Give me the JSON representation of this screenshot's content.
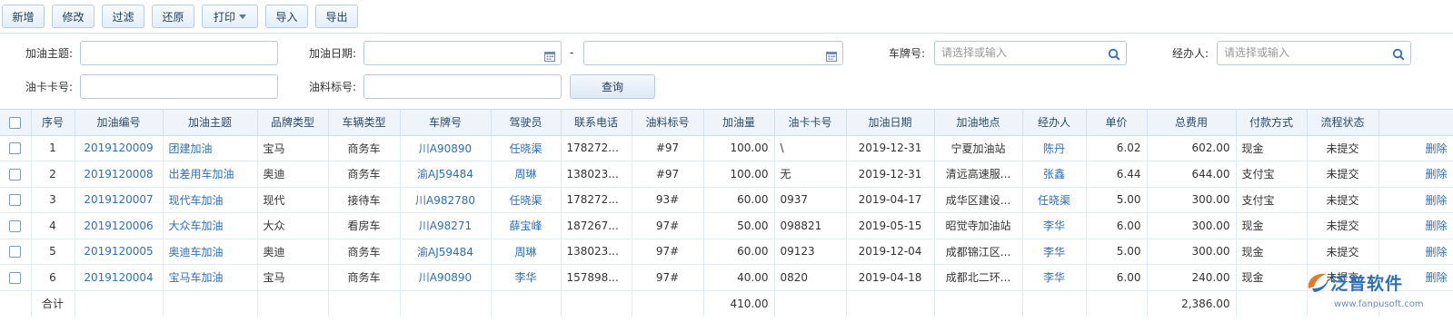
{
  "toolbar": {
    "buttons": [
      {
        "label": "新增"
      },
      {
        "label": "修改"
      },
      {
        "label": "过滤"
      },
      {
        "label": "还原"
      },
      {
        "label": "打印"
      },
      {
        "label": "导入"
      },
      {
        "label": "导出"
      }
    ]
  },
  "filters": {
    "subject_label": "加油主题:",
    "date_label": "加油日期:",
    "date_separator": "-",
    "plate_label": "车牌号:",
    "plate_placeholder": "请选择或输入",
    "handler_label": "经办人:",
    "handler_placeholder": "请选择或输入",
    "card_label": "油卡卡号:",
    "fuel_label": "油料标号:",
    "query_label": "查询"
  },
  "table": {
    "headers": [
      "序号",
      "加油编号",
      "加油主题",
      "品牌类型",
      "车辆类型",
      "车牌号",
      "驾驶员",
      "联系电话",
      "油料标号",
      "加油量",
      "油卡卡号",
      "加油日期",
      "加油地点",
      "经办人",
      "单价",
      "总费用",
      "付款方式",
      "流程状态"
    ],
    "rows": [
      {
        "no": "1",
        "code": "2019120009",
        "subject": "团建加油",
        "brand": "宝马",
        "vtype": "商务车",
        "plate": "川A90890",
        "driver": "任晓渠",
        "phone": "178272...",
        "fuel": "#97",
        "amount": "100.00",
        "card": "\\",
        "date": "2019-12-31",
        "place": "宁夏加油站",
        "handler": "陈丹",
        "price": "6.02",
        "total": "602.00",
        "pay": "现金",
        "status": "未提交",
        "action": "删除"
      },
      {
        "no": "2",
        "code": "2019120008",
        "subject": "出差用车加油",
        "brand": "奥迪",
        "vtype": "商务车",
        "plate": "渝AJ59484",
        "driver": "周琳",
        "phone": "138023...",
        "fuel": "#97",
        "amount": "100.00",
        "card": "无",
        "date": "2019-12-31",
        "place": "清远高速服...",
        "handler": "张鑫",
        "price": "6.44",
        "total": "644.00",
        "pay": "支付宝",
        "status": "未提交",
        "action": "删除"
      },
      {
        "no": "3",
        "code": "2019120007",
        "subject": "现代车加油",
        "brand": "现代",
        "vtype": "接待车",
        "plate": "川A982780",
        "driver": "任晓渠",
        "phone": "178272...",
        "fuel": "93#",
        "amount": "60.00",
        "card": "0937",
        "date": "2019-04-17",
        "place": "成华区建设...",
        "handler": "任晓渠",
        "price": "5.00",
        "total": "300.00",
        "pay": "支付宝",
        "status": "未提交",
        "action": "删除"
      },
      {
        "no": "4",
        "code": "2019120006",
        "subject": "大众车加油",
        "brand": "大众",
        "vtype": "看房车",
        "plate": "川A98271",
        "driver": "薛宝峰",
        "phone": "187267...",
        "fuel": "97#",
        "amount": "50.00",
        "card": "098821",
        "date": "2019-05-15",
        "place": "昭觉寺加油站",
        "handler": "李华",
        "price": "6.00",
        "total": "300.00",
        "pay": "现金",
        "status": "未提交",
        "action": "删除"
      },
      {
        "no": "5",
        "code": "2019120005",
        "subject": "奥迪车加油",
        "brand": "奥迪",
        "vtype": "商务车",
        "plate": "渝AJ59484",
        "driver": "周琳",
        "phone": "138023...",
        "fuel": "97#",
        "amount": "60.00",
        "card": "09123",
        "date": "2019-12-04",
        "place": "成都锦江区...",
        "handler": "李华",
        "price": "5.00",
        "total": "300.00",
        "pay": "现金",
        "status": "未提交",
        "action": "删除"
      },
      {
        "no": "6",
        "code": "2019120004",
        "subject": "宝马车加油",
        "brand": "宝马",
        "vtype": "商务车",
        "plate": "川A90890",
        "driver": "李华",
        "phone": "157898...",
        "fuel": "97#",
        "amount": "40.00",
        "card": "0820",
        "date": "2019-04-18",
        "place": "成都北二环...",
        "handler": "李华",
        "price": "6.00",
        "total": "240.00",
        "pay": "现金",
        "status": "未提交",
        "action": "删除"
      }
    ],
    "summary": {
      "label": "合计",
      "amount": "410.00",
      "total": "2,386.00"
    }
  },
  "watermark": {
    "name": "泛普软件",
    "url": "www.fanpusoft.com"
  }
}
